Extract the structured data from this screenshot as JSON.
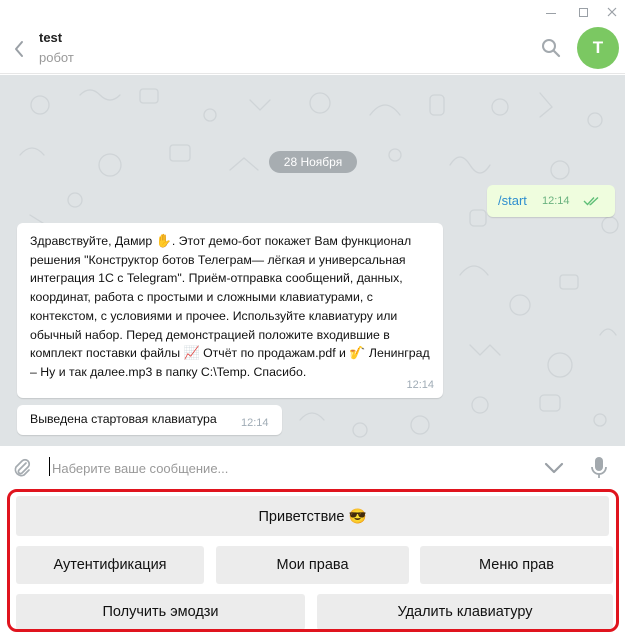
{
  "header": {
    "title": "test",
    "subtitle": "робот",
    "avatar_letter": "T",
    "avatar_color": "#7bc862"
  },
  "chat": {
    "date": "28 Ноября",
    "outgoing": {
      "text": "/start",
      "time": "12:14"
    },
    "incoming": [
      {
        "parts": {
          "p1": "Здравствуйте, Дамир ",
          "e1": "✋",
          "p2": ". Этот демо-бот покажет Вам функционал решения \"Конструктор ботов Телеграм— лёгкая и универсальная интеграция 1С с Telegram\". Приём-отправка сообщений, данных, координат, работа с простыми и сложными клавиатурами, с контекстом, с условиями и прочее. Используйте клавиатуру или обычный набор. Перед демонстрацией положите входившие в комплект поставки файлы ",
          "e2": "📈",
          "p3": " Отчёт по продажам.pdf и ",
          "e3": "🎷",
          "p4": " Ленинград – Ну и так далее.mp3 в папку C:\\Temp. Спасибо."
        },
        "time": "12:14"
      },
      {
        "text": "Выведена стартовая клавиатура",
        "time": "12:14"
      }
    ]
  },
  "composer": {
    "placeholder": "Наберите ваше сообщение..."
  },
  "keyboard": {
    "rows": [
      [
        "Приветствие 😎"
      ],
      [
        "Аутентификация",
        "Мои права",
        "Меню прав"
      ],
      [
        "Получить эмодзи",
        "Удалить клавиатуру"
      ]
    ]
  },
  "icons": {
    "back": "chevron-left-icon",
    "search": "search-icon",
    "attach": "paperclip-icon",
    "keyboard_toggle": "chevron-down-icon",
    "mic": "microphone-icon"
  },
  "colors": {
    "chat_bg": "#dfe3e5",
    "outgoing_bubble": "#effdde",
    "link": "#2f8fcf",
    "keyboard_highlight": "#e0141e"
  }
}
